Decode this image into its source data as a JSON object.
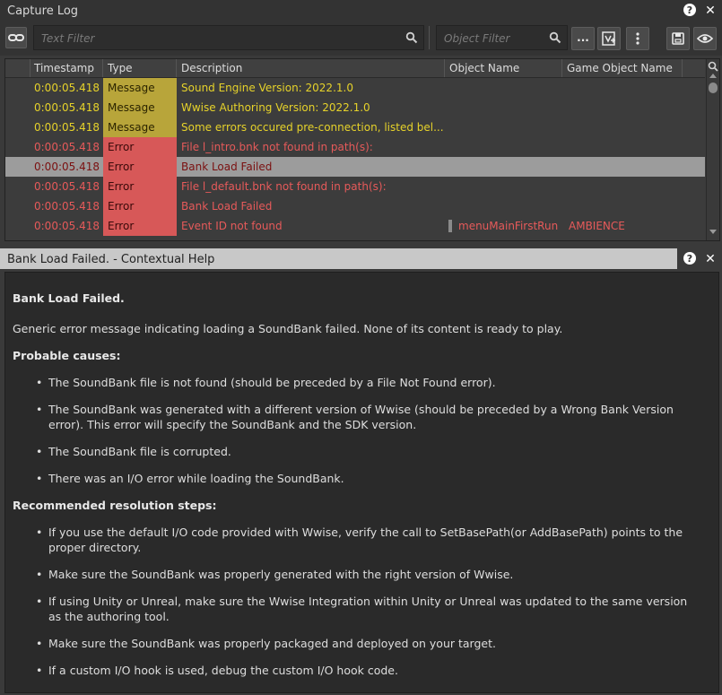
{
  "capture_log": {
    "title": "Capture Log",
    "text_filter_placeholder": "Text Filter",
    "object_filter_placeholder": "Object Filter",
    "more_button": "...",
    "columns": [
      "Timestamp",
      "Type",
      "Description",
      "Object Name",
      "Game Object Name"
    ],
    "rows": [
      {
        "timestamp": "0:00:05.418",
        "type": "Message",
        "description": "Sound Engine Version: 2022.1.0",
        "object_name": "",
        "game_object": ""
      },
      {
        "timestamp": "0:00:05.418",
        "type": "Message",
        "description": "Wwise Authoring Version: 2022.1.0",
        "object_name": "",
        "game_object": ""
      },
      {
        "timestamp": "0:00:05.418",
        "type": "Message",
        "description": "Some errors occured pre-connection, listed bel...",
        "object_name": "",
        "game_object": ""
      },
      {
        "timestamp": "0:00:05.418",
        "type": "Error",
        "description": "File l_intro.bnk not found in path(s):",
        "object_name": "",
        "game_object": ""
      },
      {
        "timestamp": "0:00:05.418",
        "type": "Error",
        "description": "Bank Load Failed",
        "object_name": "",
        "game_object": ""
      },
      {
        "timestamp": "0:00:05.418",
        "type": "Error",
        "description": "File l_default.bnk not found in path(s):",
        "object_name": "",
        "game_object": ""
      },
      {
        "timestamp": "0:00:05.418",
        "type": "Error",
        "description": "Bank Load Failed",
        "object_name": "",
        "game_object": ""
      },
      {
        "timestamp": "0:00:05.418",
        "type": "Error",
        "description": "Event ID not found",
        "object_name": "menuMainFirstRun",
        "game_object": "AMBIENCE"
      }
    ]
  },
  "help": {
    "title": "Bank Load Failed. - Contextual Help",
    "heading": "Bank Load Failed.",
    "intro": "Generic error message indicating loading a SoundBank failed. None of its content is ready to play.",
    "causes_heading": "Probable causes:",
    "causes": [
      "The SoundBank file is not found (should be preceded by a File Not Found error).",
      "The SoundBank was generated with a different version of Wwise (should be preceded by a Wrong Bank Version error). This error will specify the SoundBank and the SDK version.",
      "The SoundBank file is corrupted.",
      "There was an I/O error while loading the SoundBank."
    ],
    "steps_heading": "Recommended resolution steps:",
    "steps": [
      "If you use the default I/O code provided with Wwise, verify the call to SetBasePath(or AddBasePath) points to the proper directory.",
      "Make sure the SoundBank was properly generated with the right version of Wwise.",
      "If using Unity or Unreal, make sure the Wwise Integration within Unity or Unreal was updated to the same version as the authoring tool.",
      "Make sure the SoundBank was properly packaged and deployed on your target.",
      "If a custom I/O hook is used, debug the custom I/O hook code."
    ],
    "bullet": "•"
  },
  "icons": {
    "help": "?",
    "close": "✕"
  },
  "colors": {
    "message_text": "#e6d22a",
    "error_text": "#e65a5a",
    "message_type_bg": "#b8a53a",
    "error_type_bg": "#d75858",
    "selected_row_bg": "#9c9c9c"
  }
}
